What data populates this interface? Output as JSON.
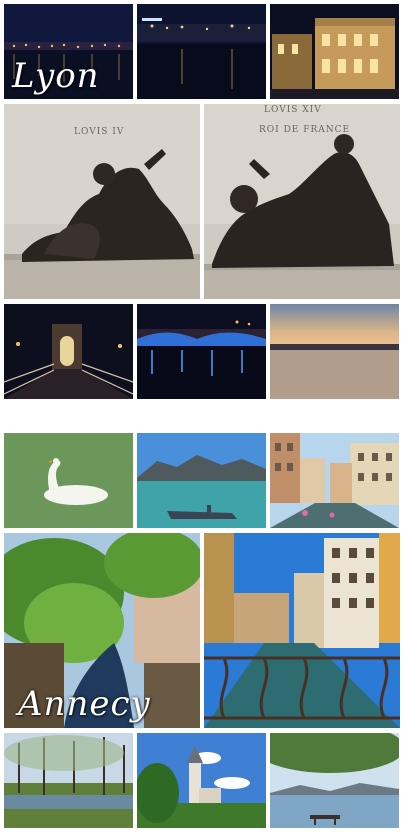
{
  "collage": {
    "lyon_label": "Lyon",
    "annecy_label": "Annecy",
    "plaque_text_left": "LOVIS IV",
    "plaque_text_right_line1": "LOVIS XIV",
    "plaque_text_right_line2": "ROI DE FRANCE"
  },
  "photos": [
    {
      "name": "lyon-night-riverfront-photo",
      "subject": "illuminated riverbank at night"
    },
    {
      "name": "lyon-night-quay-photo",
      "subject": "river quay lights at night"
    },
    {
      "name": "lyon-night-building-photo",
      "subject": "lit classical building at night"
    },
    {
      "name": "lyon-statue-saone-photo",
      "subject": "bronze reclining river statue (Saône)"
    },
    {
      "name": "lyon-statue-rhone-photo",
      "subject": "bronze reclining river statue (Rhône)"
    },
    {
      "name": "lyon-footbridge-photo",
      "subject": "footbridge at night"
    },
    {
      "name": "lyon-bridge-lights-photo",
      "subject": "bridge with blue lights at night"
    },
    {
      "name": "lyon-sunset-river-photo",
      "subject": "river at sunset"
    },
    {
      "name": "annecy-swan-photo",
      "subject": "white swan on green water"
    },
    {
      "name": "annecy-lake-boat-photo",
      "subject": "lake with boat and mountains"
    },
    {
      "name": "annecy-canal-street-photo",
      "subject": "canal lined with houses"
    },
    {
      "name": "annecy-canal-trees-photo",
      "subject": "canal with green trees"
    },
    {
      "name": "annecy-canal-railing-photo",
      "subject": "canal view through railing"
    },
    {
      "name": "annecy-park-trees-photo",
      "subject": "park with bare trees"
    },
    {
      "name": "annecy-church-photo",
      "subject": "church tower with blue sky"
    },
    {
      "name": "annecy-lake-view-photo",
      "subject": "lake view under trees"
    }
  ]
}
